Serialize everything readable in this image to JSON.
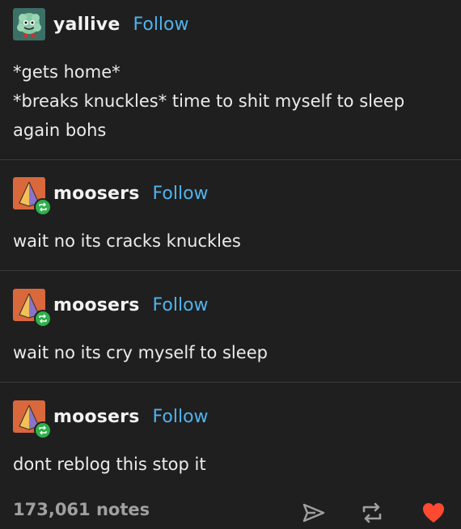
{
  "posts": [
    {
      "username": "yallive",
      "follow_label": "Follow",
      "text": "*gets home*\n*breaks knuckles* time to shit myself to sleep again bohs",
      "avatar_icon": "monster-avatar-icon",
      "reblogged": false
    },
    {
      "username": "moosers",
      "follow_label": "Follow",
      "text": "wait no its cracks knuckles",
      "avatar_icon": "pyramid-avatar-icon",
      "reblogged": true
    },
    {
      "username": "moosers",
      "follow_label": "Follow",
      "text": "wait no its cry myself to sleep",
      "avatar_icon": "pyramid-avatar-icon",
      "reblogged": true
    },
    {
      "username": "moosers",
      "follow_label": "Follow",
      "text": "dont reblog this stop it",
      "avatar_icon": "pyramid-avatar-icon",
      "reblogged": true
    }
  ],
  "footer": {
    "notes": "173,061 notes",
    "actions": [
      "share-icon",
      "reblog-icon",
      "heart-icon"
    ]
  },
  "colors": {
    "background": "#1f1f1f",
    "follow": "#4fb3ee",
    "reblog_badge": "#2db14b",
    "heart": "#ff4930",
    "divider": "#3a3a3a"
  }
}
